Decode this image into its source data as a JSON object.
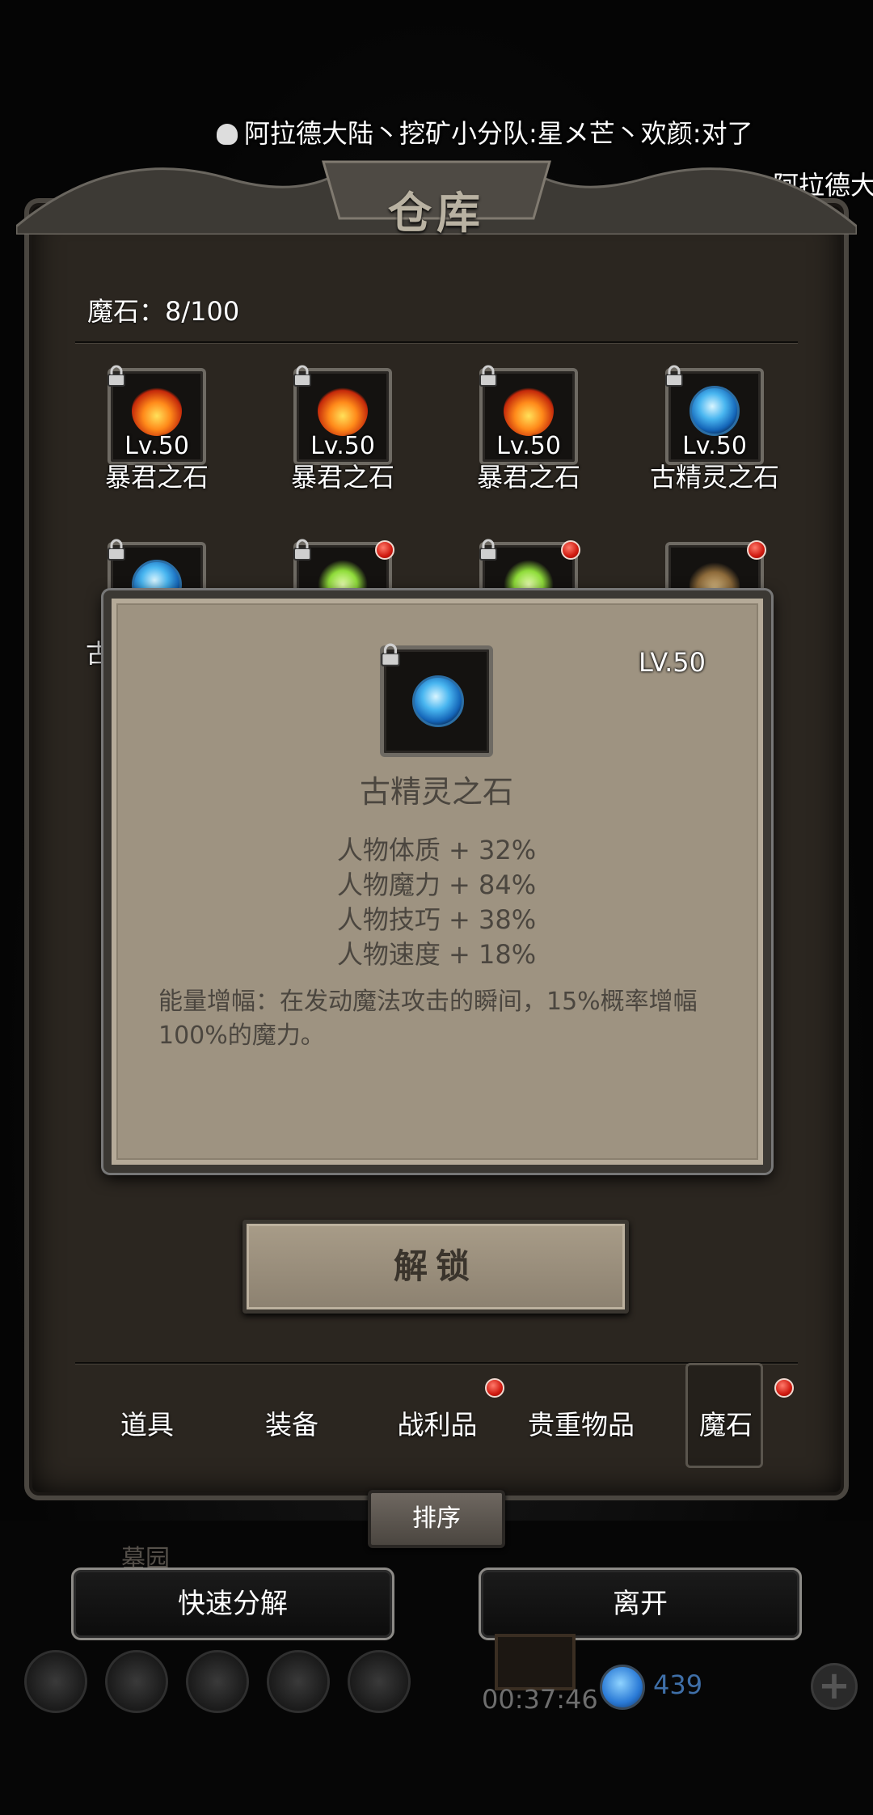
{
  "marquee": {
    "line1": "阿拉德大陆丶挖矿小分队:星メ芒丶欢颜:对了",
    "line2": "阿拉德大"
  },
  "warehouse": {
    "title": "仓库",
    "count_label": "魔石：8/100",
    "items": [
      {
        "level": "Lv.50",
        "name": "暴君之石",
        "gem": "fire",
        "locked": true
      },
      {
        "level": "Lv.50",
        "name": "暴君之石",
        "gem": "fire",
        "locked": true
      },
      {
        "level": "Lv.50",
        "name": "暴君之石",
        "gem": "fire",
        "locked": true
      },
      {
        "level": "Lv.50",
        "name": "古精灵之石",
        "gem": "ice",
        "locked": true
      },
      {
        "name_partial": "古",
        "gem": "ice",
        "locked": true,
        "new": false
      },
      {
        "gem": "green",
        "locked": true,
        "new": true
      },
      {
        "gem": "green",
        "locked": true,
        "new": true
      },
      {
        "gem": "horn",
        "locked": false,
        "new": true
      }
    ]
  },
  "detail": {
    "level": "LV.50",
    "name": "古精灵之石",
    "stats": [
      "人物体质 + 32%",
      "人物魔力 + 84%",
      "人物技巧 + 38%",
      "人物速度 + 18%"
    ],
    "description": "能量增幅：在发动魔法攻击的瞬间，15%概率增幅100%的魔力。",
    "unlock_button": "解锁"
  },
  "tabs": [
    {
      "label": "道具",
      "badge": false,
      "active": false
    },
    {
      "label": "装备",
      "badge": false,
      "active": false
    },
    {
      "label": "战利品",
      "badge": true,
      "active": false
    },
    {
      "label": "贵重物品",
      "badge": false,
      "active": false
    },
    {
      "label": "魔石",
      "badge": true,
      "active": true
    }
  ],
  "sort_button": "排序",
  "area_label": "墓园",
  "quick_decompose": "快速分解",
  "leave_button": "离开",
  "timer": "00:37:46",
  "gem_count": "439",
  "colors": {
    "panel": "#2b2620",
    "popup": "#9e9381",
    "badge_red": "#d01a10",
    "popup_text": "#4b463f"
  }
}
